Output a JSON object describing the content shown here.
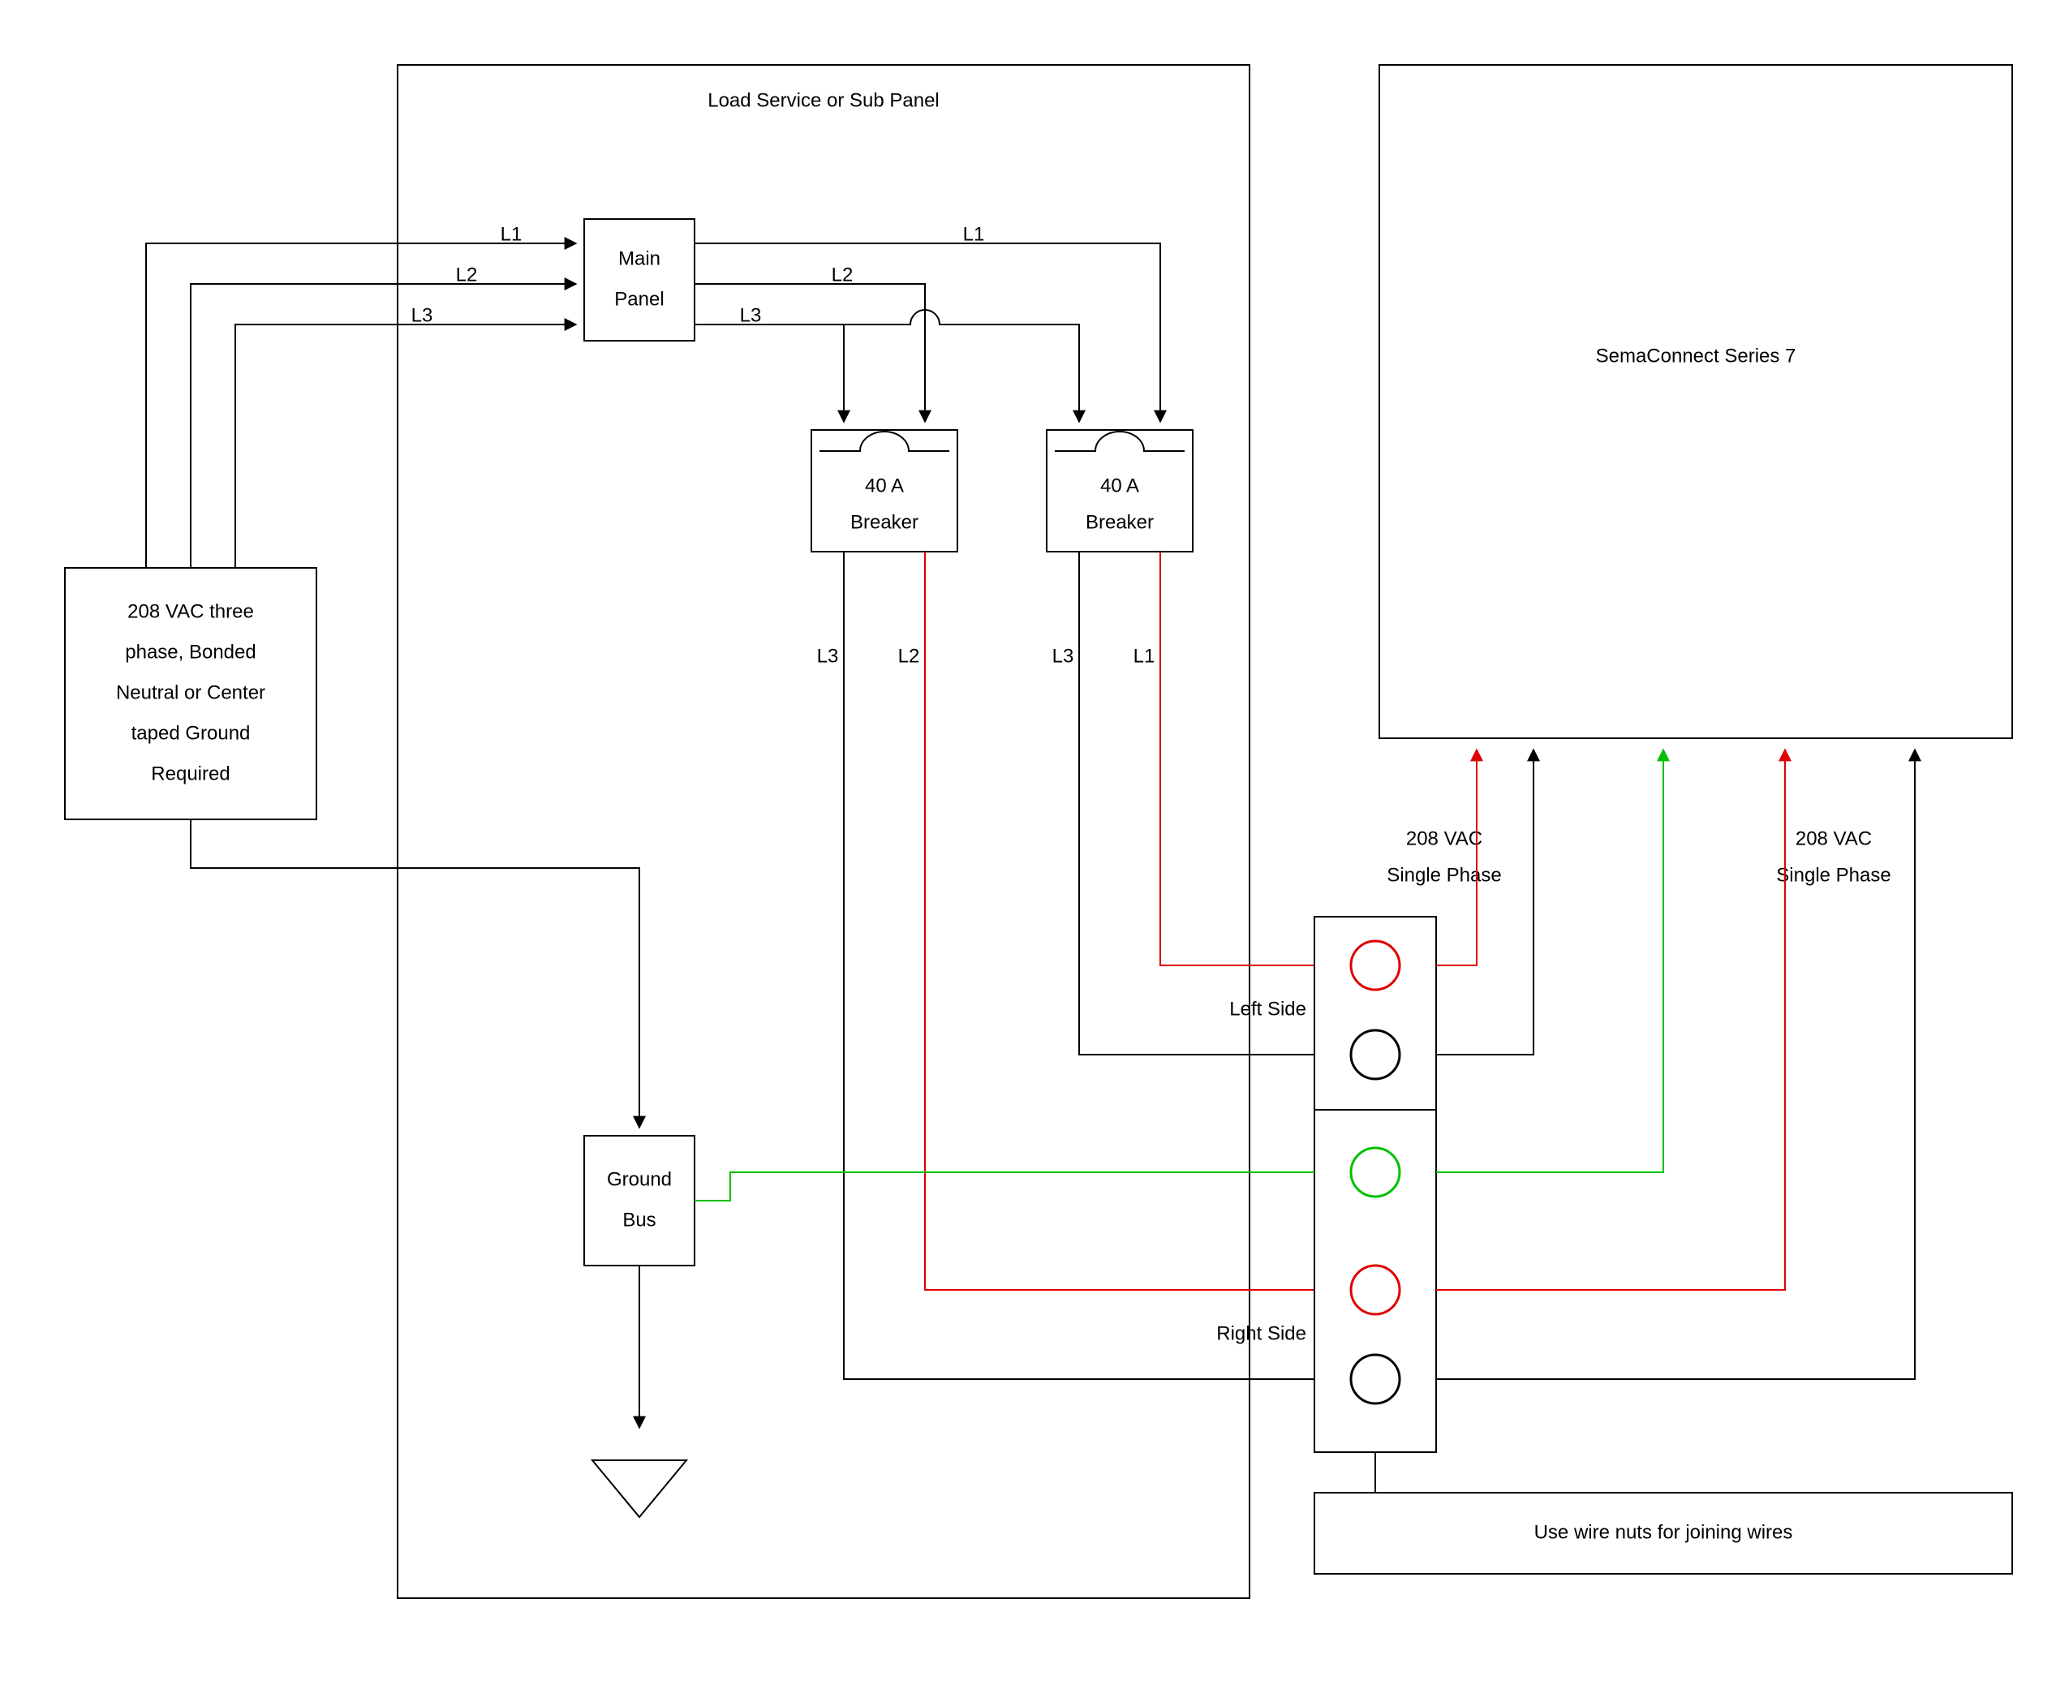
{
  "panel": {
    "title": "Load Service or Sub Panel"
  },
  "source": {
    "line1": "208 VAC three",
    "line2": "phase, Bonded",
    "line3": "Neutral or Center",
    "line4": "taped Ground",
    "line5": "Required"
  },
  "mainPanel": {
    "line1": "Main",
    "line2": "Panel"
  },
  "breaker1": {
    "line1": "40 A",
    "line2": "Breaker"
  },
  "breaker2": {
    "line1": "40 A",
    "line2": "Breaker"
  },
  "groundBus": {
    "line1": "Ground",
    "line2": "Bus"
  },
  "device": {
    "name": "SemaConnect Series 7"
  },
  "terminals": {
    "left": "Left Side",
    "right": "Right Side",
    "note": "Use wire nuts for joining wires"
  },
  "voltage1": {
    "line1": "208 VAC",
    "line2": "Single Phase"
  },
  "voltage2": {
    "line1": "208 VAC",
    "line2": "Single Phase"
  },
  "wires": {
    "l1": "L1",
    "l2": "L2",
    "l3": "L3"
  },
  "breaker1out": {
    "l3": "L3",
    "l2": "L2"
  },
  "breaker2out": {
    "l3": "L3",
    "l1": "L1"
  }
}
